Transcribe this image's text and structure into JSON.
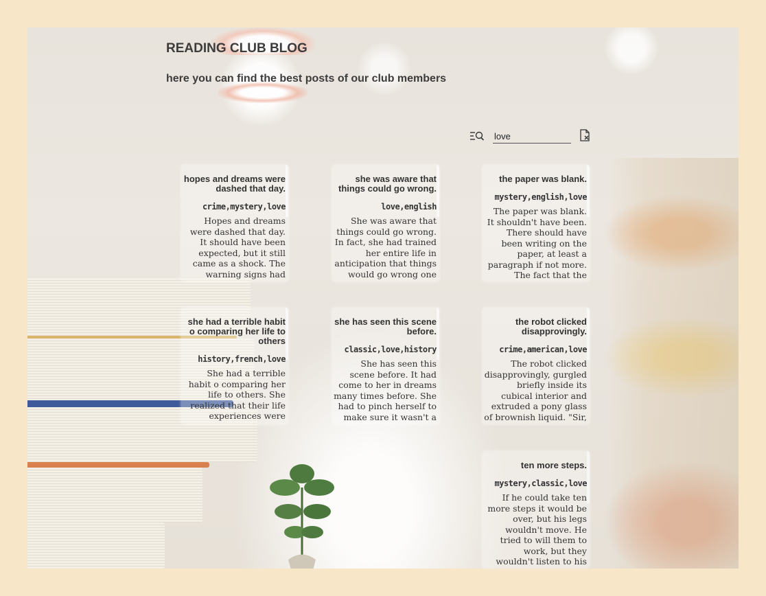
{
  "header": {
    "title": "READING CLUB BLOG",
    "subtitle": "here you can find the best posts of our club members"
  },
  "search": {
    "value": "love",
    "icon": "search-icon",
    "clear_icon": "clear-icon"
  },
  "posts": [
    {
      "title": "hopes and dreams were dashed that day.",
      "tags": "crime,mystery,love",
      "body": "Hopes and dreams were dashed that day. It should have been expected, but it still came as a shock. The warning signs had been"
    },
    {
      "title": "she was aware that things could go wrong.",
      "tags": "love,english",
      "body": "She was aware that things could go wrong. In fact, she had trained her entire life in anticipation that things would go wrong one day."
    },
    {
      "title": "the paper was blank.",
      "tags": "mystery,english,love",
      "body": "The paper was blank. It shouldn't have been. There should have been writing on the paper, at least a paragraph if not more. The fact that the writing wasn't there"
    },
    {
      "title": "she had a terrible habit o comparing her life to others",
      "tags": "history,french,love",
      "body": "She had a terrible habit o comparing her life to others. She realized that their life experiences were"
    },
    {
      "title": "she has seen this scene before.",
      "tags": "classic,love,history",
      "body": "She has seen this scene before. It had come to her in dreams many times before. She had to pinch herself to make sure it wasn't a"
    },
    {
      "title": "the robot clicked disapprovingly.",
      "tags": "crime,american,love",
      "body": "The robot clicked disapprovingly, gurgled briefly inside its cubical interior and extruded a pony glass of brownish liquid. \"Sir,"
    },
    {
      "title": "ten more steps.",
      "tags": "mystery,classic,love",
      "body": "If he could take ten more steps it would be over, but his legs wouldn't move. He tried to will them to work, but they wouldn't listen to his brain. Ten more"
    }
  ]
}
